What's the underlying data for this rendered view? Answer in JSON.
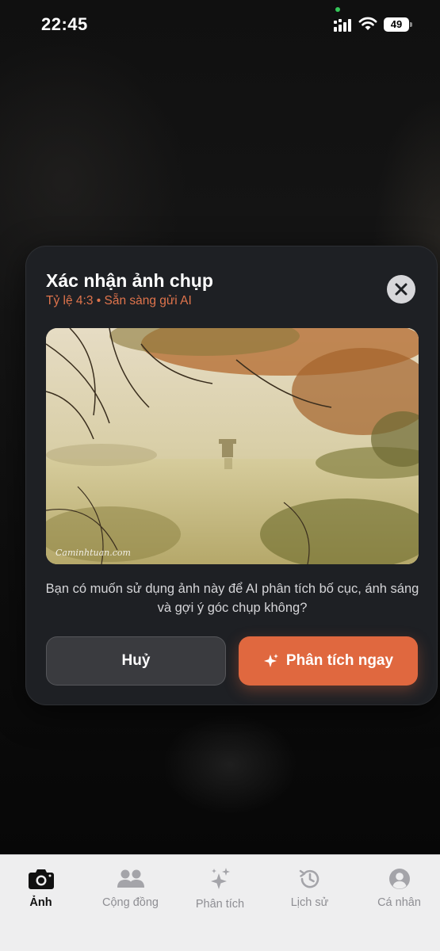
{
  "status_bar": {
    "time": "22:45",
    "battery": "49"
  },
  "modal": {
    "title": "Xác nhận ảnh chụp",
    "subtitle": "Tỷ lệ 4:3 • Sẵn sàng gửi AI",
    "photo_watermark": "Caminhtuan.com",
    "question": "Bạn có muốn sử dụng ảnh này để AI phân tích bố cục, ánh sáng và gợi ý góc chụp không?",
    "cancel_label": "Huỷ",
    "analyze_label": "Phân tích ngay",
    "accent_color": "#e0683f"
  },
  "tabbar": {
    "tabs": [
      {
        "label": "Ảnh",
        "icon": "camera-icon",
        "active": true
      },
      {
        "label": "Cộng đồng",
        "icon": "community-icon",
        "active": false
      },
      {
        "label": "Phân tích",
        "icon": "sparkles-icon",
        "active": false
      },
      {
        "label": "Lịch sử",
        "icon": "history-icon",
        "active": false
      },
      {
        "label": "Cá nhân",
        "icon": "person-icon",
        "active": false
      }
    ]
  }
}
